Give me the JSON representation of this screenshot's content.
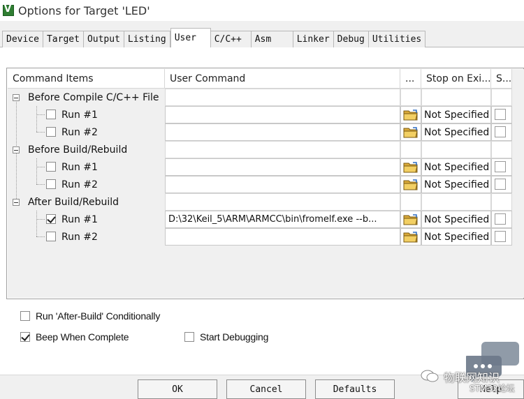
{
  "window": {
    "title": "Options for Target 'LED'"
  },
  "tabs": [
    {
      "label": "Device"
    },
    {
      "label": "Target"
    },
    {
      "label": "Output"
    },
    {
      "label": "Listing"
    },
    {
      "label": "User"
    },
    {
      "label": "C/C++"
    },
    {
      "label": "Asm"
    },
    {
      "label": "Linker"
    },
    {
      "label": "Debug"
    },
    {
      "label": "Utilities"
    }
  ],
  "active_tab": "User",
  "grid": {
    "headers": {
      "command_items": "Command Items",
      "user_command": "User Command",
      "browse": "...",
      "stop_on_exit": "Stop on Exi...",
      "s": "S..."
    },
    "groups": [
      {
        "label": "Before Compile C/C++ File",
        "runs": [
          {
            "label": "Run #1",
            "checked": false,
            "command": "",
            "stop": "Not Specified"
          },
          {
            "label": "Run #2",
            "checked": false,
            "command": "",
            "stop": "Not Specified"
          }
        ]
      },
      {
        "label": "Before Build/Rebuild",
        "runs": [
          {
            "label": "Run #1",
            "checked": false,
            "command": "",
            "stop": "Not Specified"
          },
          {
            "label": "Run #2",
            "checked": false,
            "command": "",
            "stop": "Not Specified"
          }
        ]
      },
      {
        "label": "After Build/Rebuild",
        "runs": [
          {
            "label": "Run #1",
            "checked": true,
            "command": "D:\\32\\Keil_5\\ARM\\ARMCC\\bin\\fromelf.exe  --b...",
            "stop": "Not Specified"
          },
          {
            "label": "Run #2",
            "checked": false,
            "command": "",
            "stop": "Not Specified"
          }
        ]
      }
    ]
  },
  "options": {
    "run_after_build": {
      "label": "Run 'After-Build' Conditionally",
      "checked": false
    },
    "beep": {
      "label": "Beep When Complete",
      "checked": true
    },
    "start_debug": {
      "label": "Start Debugging",
      "checked": false
    }
  },
  "buttons": {
    "ok": "OK",
    "cancel": "Cancel",
    "defaults": "Defaults",
    "help": "Help"
  },
  "watermark": {
    "line1": "物联网知识",
    "line2": "STM32论坛"
  }
}
